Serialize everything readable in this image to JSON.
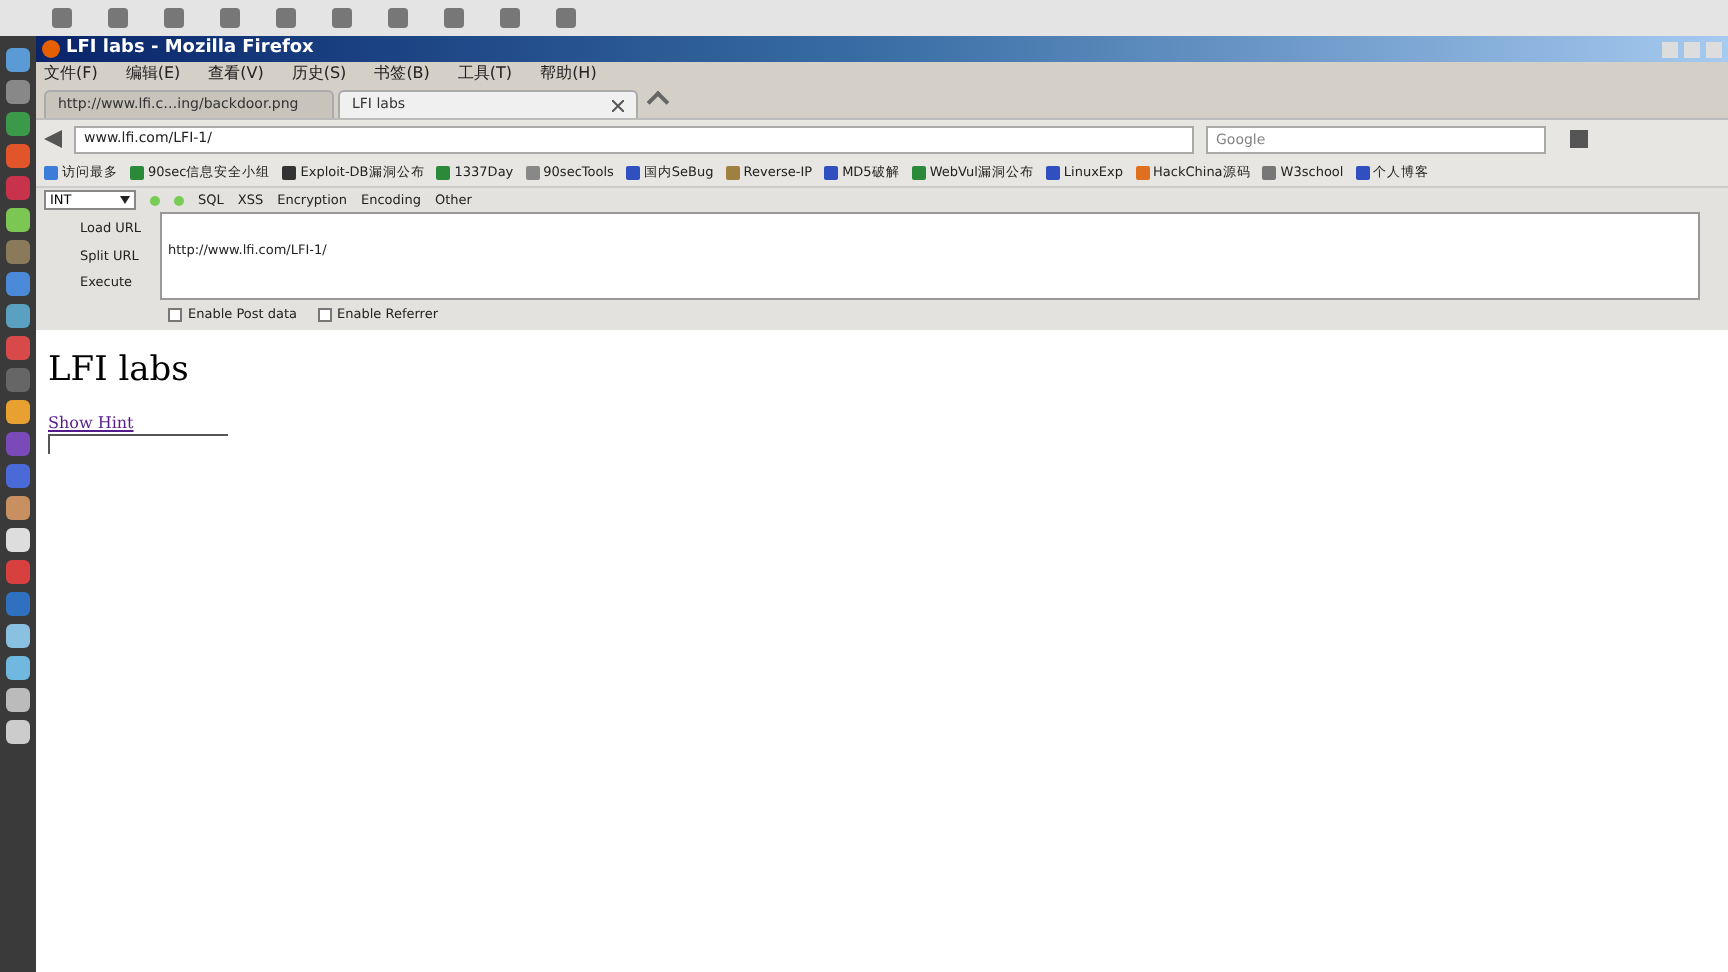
{
  "window": {
    "title": "LFI labs - Mozilla Firefox"
  },
  "menu": [
    "文件(F)",
    "编辑(E)",
    "查看(V)",
    "历史(S)",
    "书签(B)",
    "工具(T)",
    "帮助(H)"
  ],
  "tabs": [
    {
      "label": "http://www.lfi.c…ing/backdoor.png",
      "selected": false
    },
    {
      "label": "LFI labs",
      "selected": true
    }
  ],
  "address_bar": {
    "value": "www.lfi.com/LFI-1/"
  },
  "search": {
    "placeholder": "Google"
  },
  "bookmarks": [
    "访问最多",
    "90sec信息安全小组",
    "Exploit-DB漏洞公布",
    "1337Day",
    "90secTools",
    "国内SeBug",
    "Reverse-IP",
    "MD5破解",
    "WebVul漏洞公布",
    "LinuxExp",
    "HackChina源码",
    "W3school",
    "个人博客"
  ],
  "hackbar": {
    "select": "INT",
    "menus": [
      "SQL",
      "XSS",
      "Encryption",
      "Encoding",
      "Other"
    ],
    "actions": [
      "Load URL",
      "Split URL",
      "Execute"
    ],
    "url": "http://www.lfi.com/LFI-1/",
    "options": [
      {
        "label": "Enable Post data",
        "checked": false
      },
      {
        "label": "Enable Referrer",
        "checked": false
      }
    ]
  },
  "page": {
    "heading": "LFI labs",
    "link": "Show Hint"
  }
}
